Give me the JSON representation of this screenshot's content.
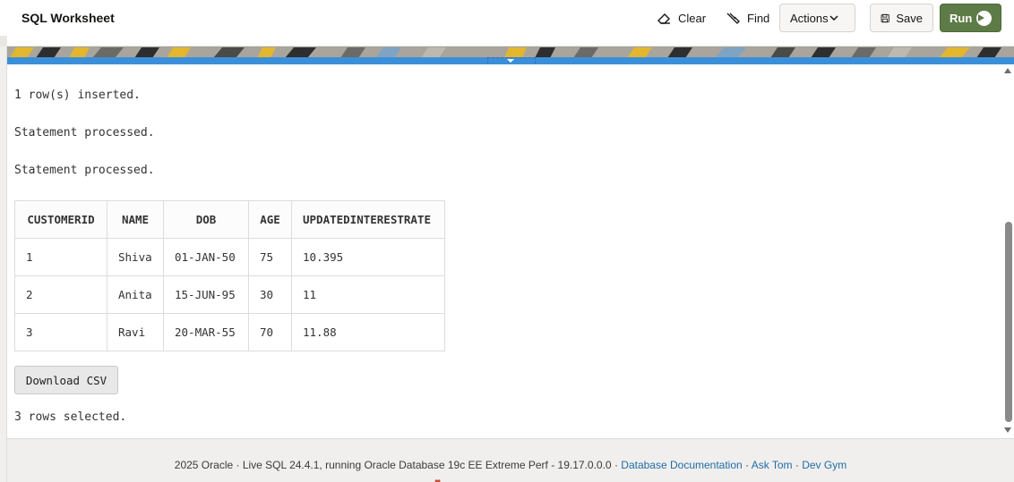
{
  "app": {
    "title": "SQL Worksheet"
  },
  "toolbar": {
    "clear_label": "Clear",
    "find_label": "Find",
    "actions_label": "Actions",
    "save_label": "Save",
    "run_label": "Run",
    "clear_icon": "eraser-icon",
    "find_icon": "find-icon",
    "save_icon": "save-icon",
    "run_icon": "play-circle-icon",
    "actions_icon": "chevron-down-icon",
    "run_color": "#5d7b46"
  },
  "results": {
    "messages": [
      "1 row(s) inserted.",
      "Statement processed.",
      "Statement processed."
    ],
    "table": {
      "columns": [
        "CUSTOMERID",
        "NAME",
        "DOB",
        "AGE",
        "UPDATEDINTERESTRATE"
      ],
      "rows": [
        [
          "1",
          "Shiva",
          "01-JAN-50",
          "75",
          "10.395"
        ],
        [
          "2",
          "Anita",
          "15-JUN-95",
          "30",
          "11"
        ],
        [
          "3",
          "Ravi",
          "20-MAR-55",
          "70",
          "11.88"
        ]
      ]
    },
    "download_label": "Download CSV",
    "rows_selected": "3 rows selected."
  },
  "footer": {
    "prefix": "2025 Oracle · Live SQL 24.4.1, running Oracle Database 19c EE Extreme Perf - 19.17.0.0.0 · ",
    "link_docs": "Database Documentation",
    "sep1": " · ",
    "link_asktom": "Ask Tom",
    "sep2": " · ",
    "link_devgym": "Dev Gym",
    "link_color": "#1f6da8"
  },
  "colors": {
    "accent_blue": "#3b8fd9",
    "footer_bg": "#f1efed"
  }
}
